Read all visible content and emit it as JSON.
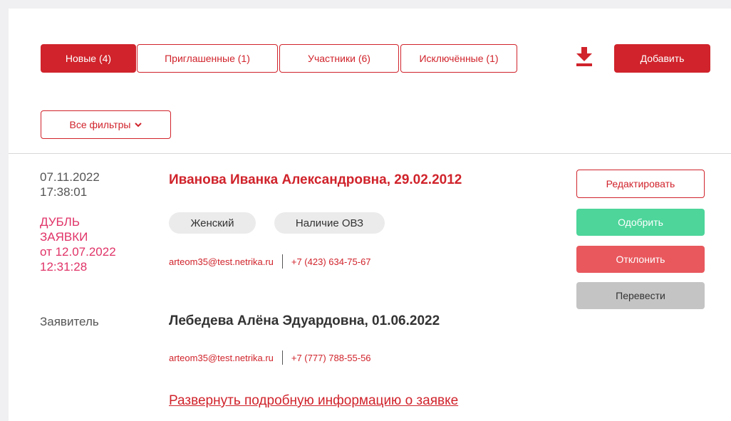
{
  "tabs": [
    {
      "label": "Новые (4)",
      "active": true
    },
    {
      "label": "Приглашенные (1)",
      "active": false
    },
    {
      "label": "Участники (6)",
      "active": false
    },
    {
      "label": "Исключённые (1)",
      "active": false
    }
  ],
  "toolbar": {
    "download_icon": "download-icon",
    "add_label": "Добавить",
    "filters_label": "Все фильтры",
    "filters_icon": "chevron-down-icon"
  },
  "application": {
    "date": "07.11.2022",
    "time": "17:38:01",
    "duplicate_line1": "ДУБЛЬ",
    "duplicate_line2": "ЗАЯВКИ",
    "duplicate_line3": "от 12.07.2022",
    "duplicate_line4": "12:31:28",
    "participant_name": "Иванова Иванка Александровна, 29.02.2012",
    "tags": [
      "Женский",
      "Наличие ОВЗ"
    ],
    "participant_email": "arteom35@test.netrika.ru",
    "participant_phone": "+7 (423) 634-75-67",
    "declarant_label": "Заявитель",
    "declarant_name": "Лебедева Алёна Эдуардовна, 01.06.2022",
    "declarant_email": "arteom35@test.netrika.ru",
    "declarant_phone": "+7 (777) 788-55-56",
    "expand_link": "Развернуть подробную информацию о заявке"
  },
  "actions": {
    "edit": "Редактировать",
    "approve": "Одобрить",
    "reject": "Отклонить",
    "transfer": "Перевести"
  },
  "colors": {
    "accent": "#d0232b",
    "approve": "#4dd59a",
    "reject": "#e8585d",
    "transfer": "#c4c4c4",
    "duplicate": "#e03368"
  }
}
